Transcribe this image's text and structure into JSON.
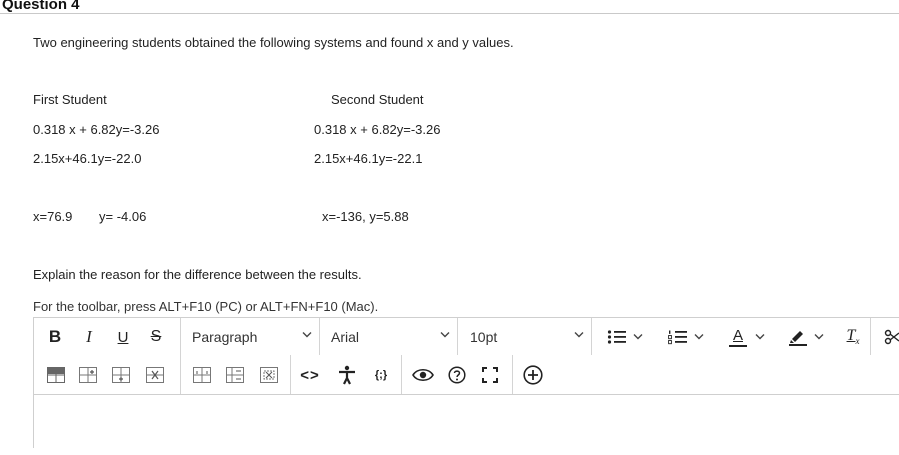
{
  "question": {
    "title": "Question 4",
    "prompt": "Two engineering students obtained the following systems and found x and y values."
  },
  "first_student": {
    "heading": "First Student",
    "eq1": "0.318 x + 6.82y=-3.26",
    "eq2": "2.15x+46.1y=-22.0",
    "x_result": "x=76.9",
    "y_result": "y= -4.06"
  },
  "second_student": {
    "heading": "Second Student",
    "eq1": "0.318 x + 6.82y=-3.26",
    "eq2": "2.15x+46.1y=-22.1",
    "result": "x=-136, y=5.88"
  },
  "explain_prompt": "Explain the reason for the difference between the results.",
  "toolbar_hint": "For the toolbar, press ALT+F10 (PC) or ALT+FN+F10 (Mac).",
  "editor": {
    "format_labels": {
      "bold": "B",
      "italic": "I",
      "underline": "U",
      "strike": "S"
    },
    "block_format": "Paragraph",
    "font_family": "Arial",
    "font_size": "10pt",
    "text_color_glyph": "A",
    "clear_format_glyph": "T",
    "clear_format_sub": "x",
    "code_glyph": "<>",
    "accessibility_glyph": "{;}"
  },
  "colors": {
    "text": "#222222",
    "border": "#cfcfcf",
    "separator": "#d4d4d4"
  }
}
